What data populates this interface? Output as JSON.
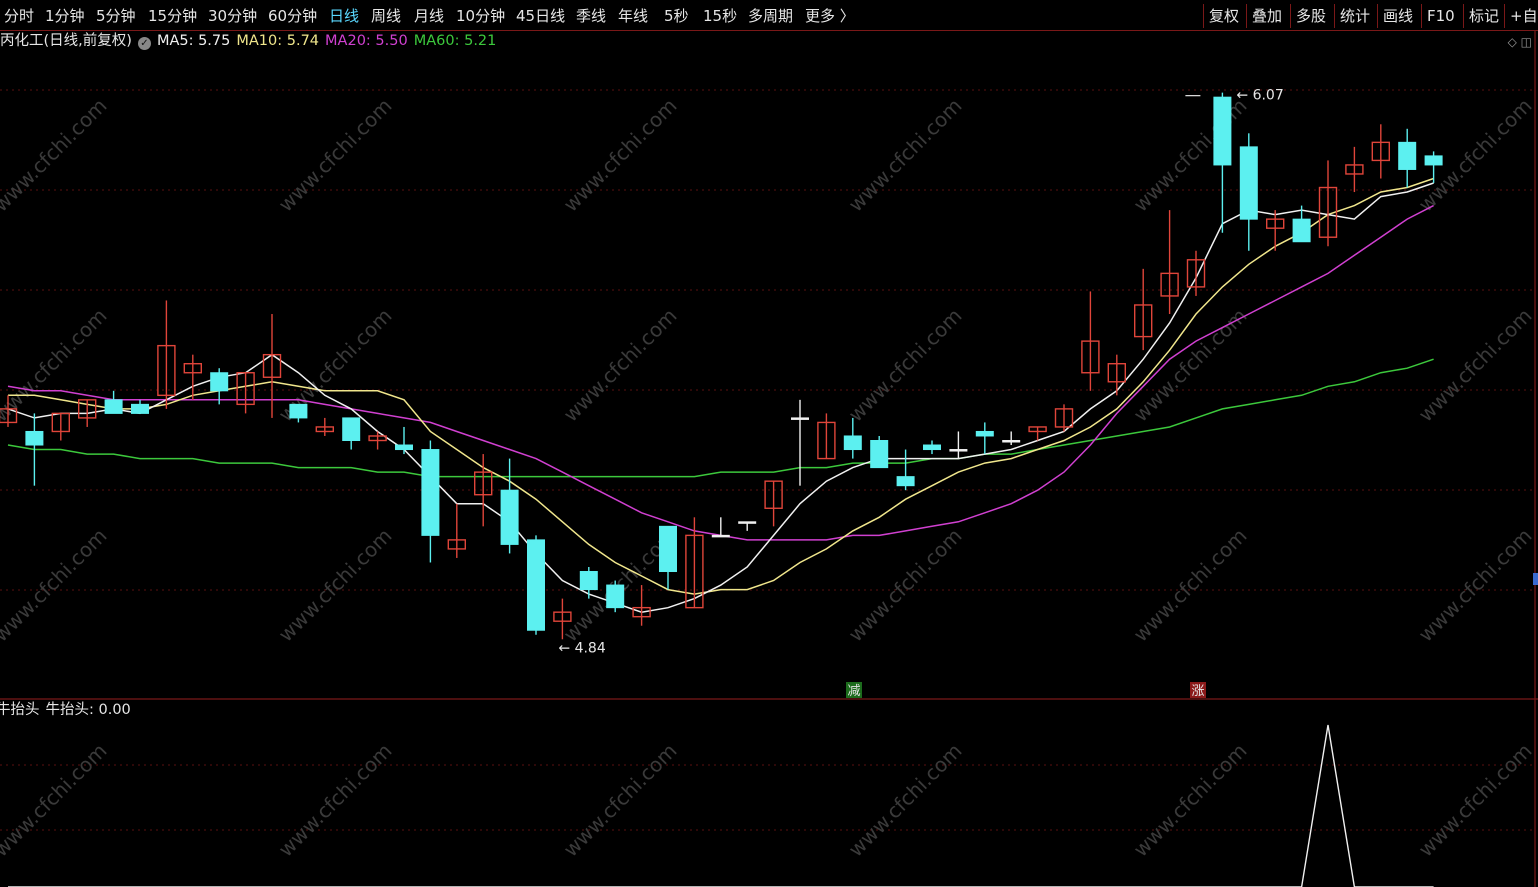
{
  "toolbar": {
    "tabs": [
      "分时",
      "1分钟",
      "5分钟",
      "15分钟",
      "30分钟",
      "60分钟",
      "日线",
      "周线",
      "月线",
      "10分钟",
      "45日线",
      "季线",
      "年线",
      "5秒",
      "15秒",
      "多周期",
      "更多 〉"
    ],
    "active_tab": "日线",
    "right_tabs": [
      "复权",
      "叠加",
      "多股",
      "统计",
      "画线",
      "F10",
      "标记",
      "+自选"
    ]
  },
  "title": {
    "stock": "丙化工(日线,前复权)",
    "ma5_label": "MA5: 5.75",
    "ma10_label": "MA10: 5.74",
    "ma20_label": "MA20: 5.50",
    "ma60_label": "MA60: 5.21"
  },
  "colors": {
    "up": "#e0453a",
    "down": "#5cf0f0",
    "ma5": "#f0f0f0",
    "ma10": "#f0e68c",
    "ma20": "#d040d0",
    "ma60": "#3cc83c",
    "grid": "#5a1010",
    "border": "#7a1818"
  },
  "sub": {
    "indicator": "牛抬头",
    "value_label": "牛抬头: 0.00"
  },
  "markers": {
    "jian": "减",
    "zhang": "涨"
  },
  "watermark": "www.cfchi.com",
  "chart_data": {
    "type": "candlestick",
    "title": "丙化工(日线,前复权)",
    "price_range": [
      4.74,
      6.17
    ],
    "high_label": "6.07",
    "low_label": "4.84",
    "candles": [
      {
        "o": 5.35,
        "h": 5.41,
        "c": 5.38,
        "l": 5.34
      },
      {
        "o": 5.33,
        "h": 5.37,
        "c": 5.3,
        "l": 5.21
      },
      {
        "o": 5.33,
        "h": 5.37,
        "c": 5.37,
        "l": 5.31
      },
      {
        "o": 5.36,
        "h": 5.39,
        "c": 5.4,
        "l": 5.34
      },
      {
        "o": 5.4,
        "h": 5.42,
        "c": 5.37,
        "l": 5.37
      },
      {
        "o": 5.39,
        "h": 5.4,
        "c": 5.37,
        "l": 5.37
      },
      {
        "o": 5.41,
        "h": 5.62,
        "c": 5.52,
        "l": 5.38
      },
      {
        "o": 5.46,
        "h": 5.5,
        "c": 5.48,
        "l": 5.4
      },
      {
        "o": 5.46,
        "h": 5.47,
        "c": 5.42,
        "l": 5.39
      },
      {
        "o": 5.39,
        "h": 5.43,
        "c": 5.46,
        "l": 5.37
      },
      {
        "o": 5.45,
        "h": 5.59,
        "c": 5.5,
        "l": 5.36
      },
      {
        "o": 5.39,
        "h": 5.38,
        "c": 5.36,
        "l": 5.35
      },
      {
        "o": 5.33,
        "h": 5.36,
        "c": 5.34,
        "l": 5.32
      },
      {
        "o": 5.36,
        "h": 5.36,
        "c": 5.31,
        "l": 5.29
      },
      {
        "o": 5.31,
        "h": 5.33,
        "c": 5.32,
        "l": 5.29
      },
      {
        "o": 5.3,
        "h": 5.34,
        "c": 5.29,
        "l": 5.28
      },
      {
        "o": 5.29,
        "h": 5.31,
        "c": 5.1,
        "l": 5.04
      },
      {
        "o": 5.07,
        "h": 5.17,
        "c": 5.09,
        "l": 5.05
      },
      {
        "o": 5.19,
        "h": 5.28,
        "c": 5.24,
        "l": 5.12
      },
      {
        "o": 5.2,
        "h": 5.27,
        "c": 5.08,
        "l": 5.06
      },
      {
        "o": 5.09,
        "h": 5.1,
        "c": 4.89,
        "l": 4.88
      },
      {
        "o": 4.91,
        "h": 4.96,
        "c": 4.93,
        "l": 4.87
      },
      {
        "o": 5.02,
        "h": 5.03,
        "c": 4.98,
        "l": 4.96
      },
      {
        "o": 4.99,
        "h": 5.0,
        "c": 4.94,
        "l": 4.93
      },
      {
        "o": 4.92,
        "h": 4.99,
        "c": 4.94,
        "l": 4.9
      },
      {
        "o": 5.12,
        "h": 5.07,
        "c": 5.02,
        "l": 4.98
      },
      {
        "o": 4.94,
        "h": 5.14,
        "c": 5.1,
        "l": 4.94
      },
      {
        "o": 5.1,
        "h": 5.14,
        "c": 5.1,
        "l": 5.1
      },
      {
        "o": 5.13,
        "h": 5.12,
        "c": 5.13,
        "l": 5.11
      },
      {
        "o": 5.16,
        "h": 5.22,
        "c": 5.22,
        "l": 5.12
      },
      {
        "o": 5.36,
        "h": 5.4,
        "c": 5.36,
        "l": 5.21
      },
      {
        "o": 5.27,
        "h": 5.37,
        "c": 5.35,
        "l": 5.28
      },
      {
        "o": 5.32,
        "h": 5.36,
        "c": 5.29,
        "l": 5.27
      },
      {
        "o": 5.31,
        "h": 5.32,
        "c": 5.25,
        "l": 5.27
      },
      {
        "o": 5.23,
        "h": 5.29,
        "c": 5.21,
        "l": 5.2
      },
      {
        "o": 5.3,
        "h": 5.31,
        "c": 5.29,
        "l": 5.28
      },
      {
        "o": 5.29,
        "h": 5.33,
        "c": 5.29,
        "l": 5.27
      },
      {
        "o": 5.33,
        "h": 5.35,
        "c": 5.32,
        "l": 5.28
      },
      {
        "o": 5.31,
        "h": 5.33,
        "c": 5.31,
        "l": 5.3
      },
      {
        "o": 5.33,
        "h": 5.33,
        "c": 5.34,
        "l": 5.31
      },
      {
        "o": 5.34,
        "h": 5.39,
        "c": 5.38,
        "l": 5.33
      },
      {
        "o": 5.46,
        "h": 5.64,
        "c": 5.53,
        "l": 5.42
      },
      {
        "o": 5.44,
        "h": 5.5,
        "c": 5.48,
        "l": 5.41
      },
      {
        "o": 5.54,
        "h": 5.69,
        "c": 5.61,
        "l": 5.51
      },
      {
        "o": 5.63,
        "h": 5.82,
        "c": 5.68,
        "l": 5.59
      },
      {
        "o": 5.65,
        "h": 5.73,
        "c": 5.71,
        "l": 5.63
      },
      {
        "o": 6.07,
        "h": 6.08,
        "c": 5.92,
        "l": 5.77
      },
      {
        "o": 5.96,
        "h": 5.99,
        "c": 5.8,
        "l": 5.73
      },
      {
        "o": 5.78,
        "h": 5.82,
        "c": 5.8,
        "l": 5.73
      },
      {
        "o": 5.8,
        "h": 5.83,
        "c": 5.75,
        "l": 5.76
      },
      {
        "o": 5.76,
        "h": 5.93,
        "c": 5.87,
        "l": 5.74
      },
      {
        "o": 5.9,
        "h": 5.96,
        "c": 5.92,
        "l": 5.86
      },
      {
        "o": 5.93,
        "h": 6.01,
        "c": 5.97,
        "l": 5.89
      },
      {
        "o": 5.97,
        "h": 6.0,
        "c": 5.91,
        "l": 5.87
      },
      {
        "o": 5.94,
        "h": 5.95,
        "c": 5.92,
        "l": 5.88
      }
    ],
    "ma5": [
      5.38,
      5.36,
      5.37,
      5.37,
      5.38,
      5.37,
      5.4,
      5.43,
      5.45,
      5.46,
      5.5,
      5.46,
      5.41,
      5.38,
      5.33,
      5.29,
      5.23,
      5.17,
      5.17,
      5.13,
      5.06,
      5.0,
      4.97,
      4.95,
      4.93,
      4.94,
      4.96,
      4.99,
      5.03,
      5.1,
      5.17,
      5.22,
      5.25,
      5.27,
      5.27,
      5.27,
      5.27,
      5.28,
      5.29,
      5.31,
      5.33,
      5.38,
      5.42,
      5.49,
      5.57,
      5.67,
      5.79,
      5.82,
      5.81,
      5.82,
      5.81,
      5.8,
      5.85,
      5.86,
      5.88
    ],
    "ma10": [
      5.41,
      5.41,
      5.4,
      5.39,
      5.38,
      5.38,
      5.39,
      5.41,
      5.42,
      5.43,
      5.44,
      5.43,
      5.42,
      5.42,
      5.42,
      5.4,
      5.33,
      5.29,
      5.25,
      5.22,
      5.18,
      5.13,
      5.08,
      5.04,
      5.01,
      4.98,
      4.97,
      4.98,
      4.98,
      5.0,
      5.04,
      5.07,
      5.11,
      5.14,
      5.18,
      5.21,
      5.24,
      5.26,
      5.27,
      5.29,
      5.31,
      5.34,
      5.38,
      5.44,
      5.51,
      5.59,
      5.65,
      5.7,
      5.74,
      5.77,
      5.81,
      5.83,
      5.86,
      5.87,
      5.89
    ],
    "ma20": [
      5.43,
      5.42,
      5.42,
      5.41,
      5.4,
      5.4,
      5.4,
      5.4,
      5.4,
      5.4,
      5.4,
      5.4,
      5.39,
      5.38,
      5.37,
      5.36,
      5.35,
      5.33,
      5.31,
      5.29,
      5.27,
      5.24,
      5.21,
      5.18,
      5.15,
      5.13,
      5.11,
      5.1,
      5.09,
      5.09,
      5.09,
      5.09,
      5.1,
      5.1,
      5.11,
      5.12,
      5.13,
      5.15,
      5.17,
      5.2,
      5.24,
      5.3,
      5.37,
      5.43,
      5.49,
      5.53,
      5.56,
      5.59,
      5.62,
      5.65,
      5.68,
      5.72,
      5.76,
      5.8,
      5.83
    ],
    "ma60": [
      5.3,
      5.29,
      5.29,
      5.28,
      5.28,
      5.27,
      5.27,
      5.27,
      5.26,
      5.26,
      5.26,
      5.25,
      5.25,
      5.25,
      5.24,
      5.24,
      5.23,
      5.23,
      5.23,
      5.23,
      5.23,
      5.23,
      5.23,
      5.23,
      5.23,
      5.23,
      5.23,
      5.24,
      5.24,
      5.24,
      5.25,
      5.25,
      5.26,
      5.26,
      5.26,
      5.27,
      5.27,
      5.28,
      5.28,
      5.29,
      5.3,
      5.31,
      5.32,
      5.33,
      5.34,
      5.36,
      5.38,
      5.39,
      5.4,
      5.41,
      5.43,
      5.44,
      5.46,
      5.47,
      5.49
    ],
    "sub_values": [
      0,
      0,
      0,
      0,
      0,
      0,
      0,
      0,
      0,
      0,
      0,
      0,
      0,
      0,
      0,
      0,
      0,
      0,
      0,
      0,
      0,
      0,
      0,
      0,
      0,
      0,
      0,
      0,
      0,
      0,
      0,
      0,
      0,
      0,
      0,
      0,
      0,
      0,
      0,
      0,
      0,
      0,
      0,
      0,
      0,
      0,
      0,
      0,
      0,
      0,
      1,
      0,
      0,
      0,
      0
    ]
  }
}
